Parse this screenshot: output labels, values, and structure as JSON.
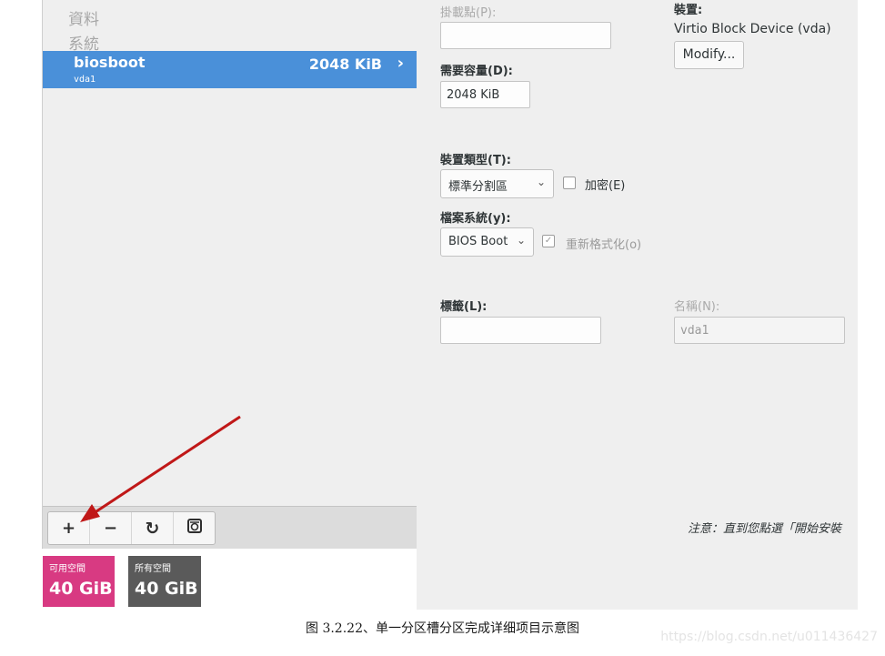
{
  "left_panel": {
    "groups": [
      "資料",
      "系統"
    ],
    "partition": {
      "name": "biosboot",
      "device": "vda1",
      "size": "2048 KiB",
      "chevron_icon": "chevron-right-icon"
    },
    "toolbar": [
      {
        "name": "add-partition-button",
        "icon": "plus-icon",
        "glyph": "+"
      },
      {
        "name": "remove-partition-button",
        "icon": "minus-icon",
        "glyph": "−"
      },
      {
        "name": "refresh-button",
        "icon": "refresh-icon",
        "glyph": "↻"
      },
      {
        "name": "configure-button",
        "icon": "disk-settings-icon",
        "glyph": "⊛"
      }
    ],
    "space": {
      "available_label": "可用空間",
      "available_value": "40 GiB",
      "total_label": "所有空間",
      "total_value": "40 GiB"
    }
  },
  "detail": {
    "mount_point_label": "掛載點(P):",
    "mount_point_value": "",
    "device_label": "裝置:",
    "device_value": "Virtio Block Device (vda)",
    "modify_label": "Modify...",
    "desired_capacity_label": "需要容量(D):",
    "desired_capacity_value": "2048 KiB",
    "device_type_label": "裝置類型(T):",
    "device_type_value": "標準分割區",
    "encrypt_label": "加密(E)",
    "filesystem_label": "檔案系統(y):",
    "filesystem_value": "BIOS Boot",
    "reformat_label": "重新格式化(o)",
    "label_label": "標籤(L):",
    "label_value": "",
    "name_label": "名稱(N):",
    "name_value": "vda1",
    "note": "注意：直到您點選「開始安裝"
  },
  "caption": "图 3.2.22、单一分区槽分区完成详细项目示意图",
  "watermark": "https://blog.csdn.net/u011436427",
  "colors": {
    "selection": "#4a90d9",
    "available_tile": "#d83a82",
    "total_tile": "#5a5a5a",
    "arrow": "#c01818"
  }
}
